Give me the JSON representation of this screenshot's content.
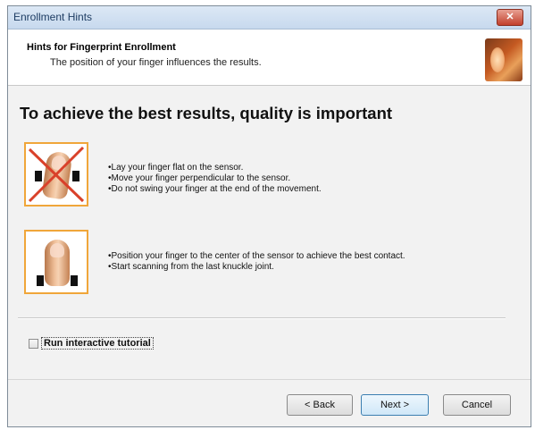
{
  "window": {
    "title": "Enrollment Hints",
    "close_label": "✕"
  },
  "header": {
    "title": "Hints for Fingerprint Enrollment",
    "subtitle": "The position of your finger influences the results."
  },
  "main": {
    "heading": "To achieve the best results, quality is important",
    "hints": [
      {
        "kind": "incorrect",
        "lines": [
          "•Lay your finger flat on the sensor.",
          "•Move your finger perpendicular to the sensor.",
          "•Do not swing your finger at the end of the movement."
        ]
      },
      {
        "kind": "correct",
        "lines": [
          "•Position your finger to the center of the sensor to achieve the best contact.",
          "•Start scanning from the last knuckle joint."
        ]
      }
    ]
  },
  "tutorial": {
    "label": "Run interactive tutorial",
    "checked": false
  },
  "buttons": {
    "back": "< Back",
    "next": "Next >",
    "cancel": "Cancel"
  },
  "colors": {
    "hint_border": "#f0a63a",
    "cross": "#d9412a",
    "titlebar": "#c7d9ee"
  }
}
